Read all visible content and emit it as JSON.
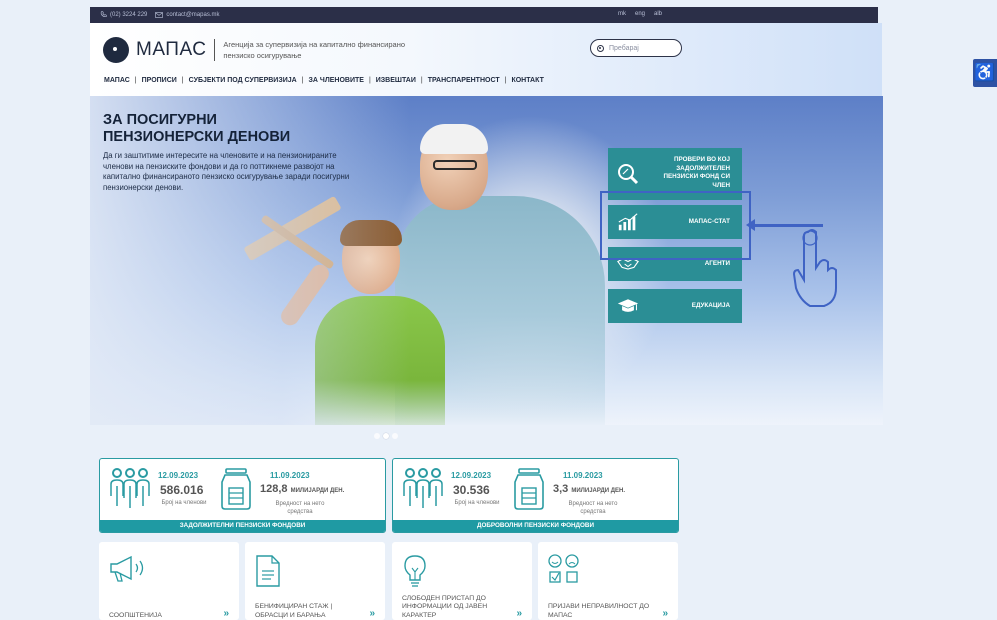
{
  "topbar": {
    "phone": "(02) 3224 229",
    "email": "contact@mapas.mk",
    "languages": [
      "mk",
      "eng",
      "alb"
    ]
  },
  "logo": {
    "name": "МАПАС",
    "tagline": "Агенција за супервизија на капитално финансирано пензиско осигурување"
  },
  "search": {
    "placeholder": "Пребарај"
  },
  "nav": [
    "МАПАС",
    "ПРОПИСИ",
    "СУБЈЕКТИ ПОД СУПЕРВИЗИЈА",
    "ЗА ЧЛЕНОВИТЕ",
    "ИЗВЕШТАИ",
    "ТРАНСПАРЕНТНОСТ",
    "КОНТАКТ"
  ],
  "accessibility": {
    "icon": "accessibility-icon",
    "glyph": "♿"
  },
  "hero": {
    "title_line1": "ЗА ПОСИГУРНИ",
    "title_line2": "ПЕНЗИОНЕРСКИ ДЕНОВИ",
    "text": "Да ги заштитиме интересите на членовите и на пензионираните членови на пензиските фондови и да го поттикнеме развојот на капитално финансираното пензиско осигурување заради посигурни пензионерски денови."
  },
  "cards": [
    {
      "label": "ПРОВЕРИ ВО КОЈ ЗАДОЛЖИТЕЛЕН ПЕНЗИСКИ ФОНД СИ ЧЛЕН",
      "icon": "search-icon"
    },
    {
      "label": "МАПАС-СТАТ",
      "icon": "bar-chart-icon"
    },
    {
      "label": "АГЕНТИ",
      "icon": "handshake-icon"
    },
    {
      "label": "ЕДУКАЦИЈА",
      "icon": "graduation-cap-icon"
    }
  ],
  "slider": {
    "total": 3,
    "active": 2
  },
  "stats": [
    {
      "date1": "12.09.2023",
      "value1": "586.016",
      "label1": "Број на членови",
      "date2": "11.09.2023",
      "value2": "128,8",
      "unit2": "МИЛИЈАРДИ ДЕН.",
      "label2": "Вредност на нето средства",
      "footer": "ЗАДОЛЖИТЕЛНИ ПЕНЗИСКИ ФОНДОВИ"
    },
    {
      "date1": "12.09.2023",
      "value1": "30.536",
      "label1": "Број на членови",
      "date2": "11.09.2023",
      "value2": "3,3",
      "unit2": "МИЛИЈАРДИ ДЕН.",
      "label2": "Вредност на нето средства",
      "footer": "ДОБРОВОЛНИ ПЕНЗИСКИ ФОНДОВИ"
    }
  ],
  "tiles": [
    {
      "label": "СООПШТЕНИЈА",
      "icon": "megaphone-icon"
    },
    {
      "label": "БЕНИФИЦИРАН СТАЖ | ОБРАСЦИ И БАРАЊА",
      "icon": "document-icon"
    },
    {
      "label": "СЛОБОДЕН ПРИСТАП ДО ИНФОРМАЦИИ ОД ЈАВЕН КАРАКТЕР",
      "icon": "lightbulb-icon"
    },
    {
      "label": "ПРИЈАВИ НЕПРАВИЛНОСТ ДО МАПАС",
      "icon": "feedback-faces-icon"
    }
  ],
  "colors": {
    "teal": "#2a9ba2",
    "navy": "#2b2f48",
    "highlight": "#3f63c4"
  }
}
